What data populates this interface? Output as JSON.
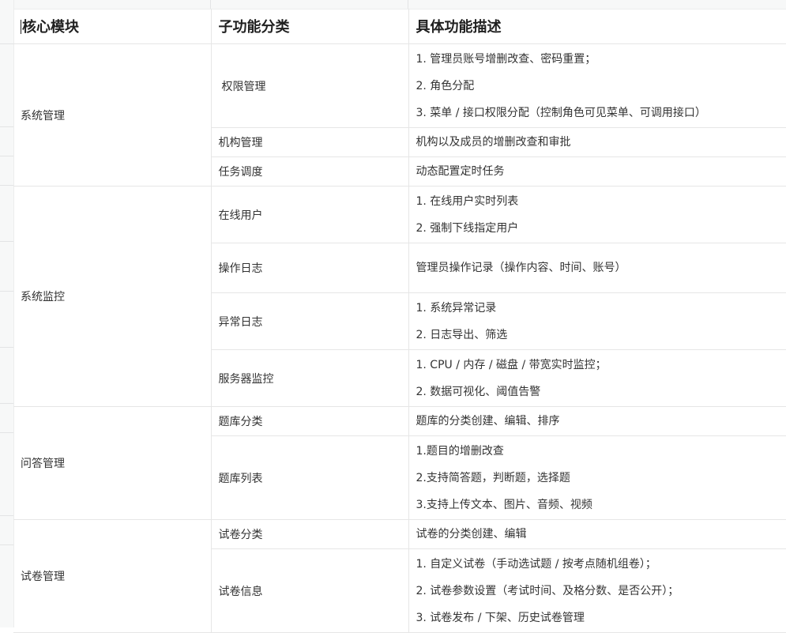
{
  "header": {
    "col1": "核心模块",
    "col2": "子功能分类",
    "col3": "具体功能描述"
  },
  "modules": [
    {
      "name": "系统管理",
      "subs": [
        {
          "name": "权限管理",
          "lines": [
            "1. 管理员账号增删改查、密码重置；",
            "2. 角色分配",
            "3. 菜单 / 接口权限分配（控制角色可见菜单、可调用接口）"
          ]
        },
        {
          "name": "机构管理",
          "lines": [
            "机构以及成员的增删改查和审批"
          ]
        },
        {
          "name": "任务调度",
          "lines": [
            "动态配置定时任务"
          ]
        }
      ]
    },
    {
      "name": "系统监控",
      "subs": [
        {
          "name": "在线用户",
          "lines": [
            "1. 在线用户实时列表",
            "2. 强制下线指定用户"
          ]
        },
        {
          "name": "操作日志",
          "lines": [
            "管理员操作记录（操作内容、时间、账号）"
          ]
        },
        {
          "name": "异常日志",
          "lines": [
            "1. 系统异常记录",
            "2. 日志导出、筛选"
          ]
        },
        {
          "name": "服务器监控",
          "lines": [
            "1. CPU / 内存 / 磁盘 / 带宽实时监控；",
            "2. 数据可视化、阈值告警"
          ]
        }
      ]
    },
    {
      "name": "问答管理",
      "subs": [
        {
          "name": "题库分类",
          "lines": [
            "题库的分类创建、编辑、排序"
          ]
        },
        {
          "name": "题库列表",
          "lines": [
            "1.题目的增删改查",
            "2.支持简答题，判断题，选择题",
            "3.支持上传文本、图片、音频、视频"
          ]
        }
      ]
    },
    {
      "name": "试卷管理",
      "subs": [
        {
          "name": "试卷分类",
          "lines": [
            "试卷的分类创建、编辑"
          ]
        },
        {
          "name": "试卷信息",
          "lines": [
            "1. 自定义试卷（手动选试题 / 按考点随机组卷）；",
            "2. 试卷参数设置（考试时间、及格分数、是否公开）；",
            "3. 试卷发布 / 下架、历史试卷管理"
          ]
        }
      ]
    }
  ]
}
